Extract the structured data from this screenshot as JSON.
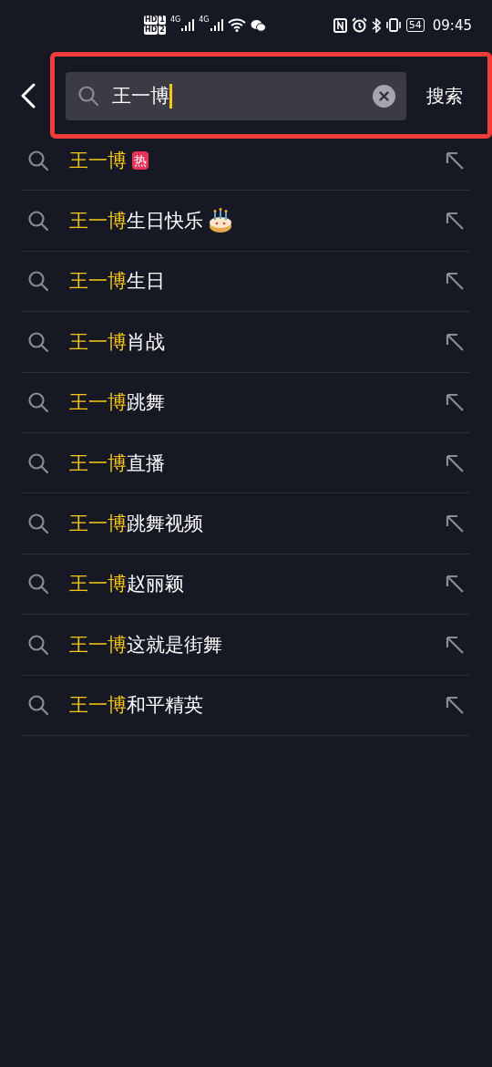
{
  "status_bar": {
    "sims": [
      {
        "label": "HD",
        "slot": "1"
      },
      {
        "label": "HD",
        "slot": "2"
      }
    ],
    "networks": [
      "4G",
      "4G"
    ],
    "battery": "54",
    "time": "09:45"
  },
  "search": {
    "value": "王一博",
    "button": "搜索",
    "highlighted": true
  },
  "suggestions": [
    {
      "match": "王一博",
      "kind": "hot",
      "badge": "热"
    },
    {
      "match": "王一博",
      "rest": "生日快乐",
      "kind": "emoji"
    },
    {
      "match": "王一博",
      "rest": "生日",
      "kind": "plain"
    },
    {
      "match": "王一博",
      "rest": "肖战",
      "kind": "plain"
    },
    {
      "match": "王一博",
      "rest": "跳舞",
      "kind": "plain"
    },
    {
      "match": "王一博",
      "rest": "直播",
      "kind": "plain"
    },
    {
      "match": "王一博",
      "rest": "跳舞视频",
      "kind": "plain"
    },
    {
      "match": "王一博",
      "rest": "赵丽颖",
      "kind": "plain"
    },
    {
      "match": "王一博",
      "rest": "这就是街舞",
      "kind": "plain"
    },
    {
      "match": "王一博",
      "rest": "和平精英",
      "kind": "plain"
    }
  ]
}
